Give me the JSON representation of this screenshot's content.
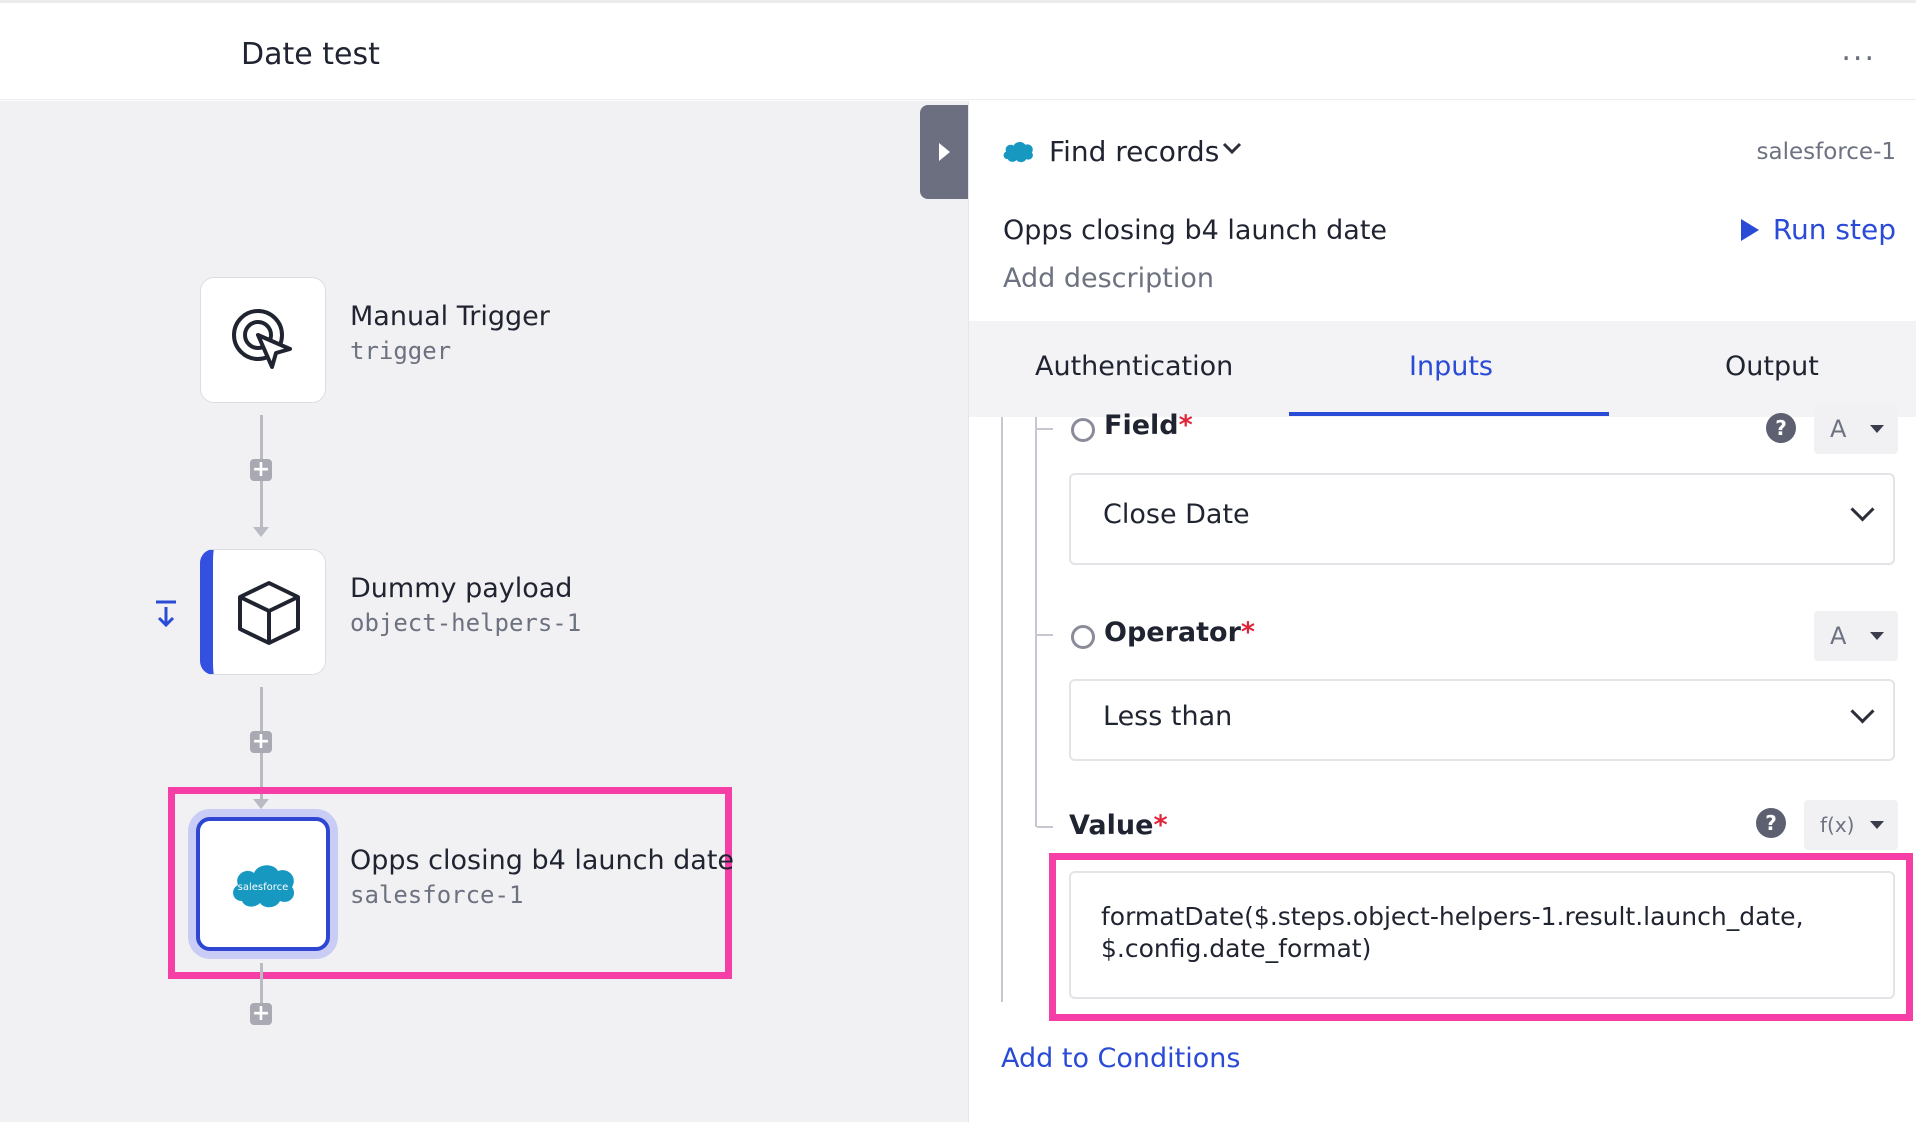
{
  "header": {
    "title": "Date test",
    "more_label": "..."
  },
  "canvas": {
    "nodes": [
      {
        "title": "Manual Trigger",
        "subtitle": "trigger",
        "icon": "cursor-click-icon"
      },
      {
        "title": "Dummy payload",
        "subtitle": "object-helpers-1",
        "icon": "cube-icon"
      },
      {
        "title": "Opps closing b4 launch date",
        "subtitle": "salesforce-1",
        "icon": "salesforce-logo-icon",
        "logo_text": "salesforce"
      }
    ],
    "add_step_symbol": "+"
  },
  "panel": {
    "step_type": "Find records",
    "step_id": "salesforce-1",
    "step_name": "Opps closing b4 launch date",
    "run_step_label": "Run step",
    "add_description": "Add description",
    "tabs": [
      {
        "label": "Authentication"
      },
      {
        "label": "Inputs",
        "active": true
      },
      {
        "label": "Output"
      }
    ],
    "fields": {
      "field": {
        "label": "Field",
        "required_mark": "*",
        "type_label": "A",
        "value": "Close Date"
      },
      "operator": {
        "label": "Operator",
        "required_mark": "*",
        "type_label": "A",
        "value": "Less than"
      },
      "value": {
        "label": "Value",
        "required_mark": "*",
        "type_label": "f(x)",
        "expression_line1": "formatDate($.steps.object-helpers-1.result.launch_date,",
        "expression_line2": "$.config.date_format)"
      }
    },
    "help_symbol": "?",
    "add_conditions_label": "Add to Conditions"
  },
  "colors": {
    "accent": "#2a4bd6",
    "highlight": "#f53fa7",
    "salesforce": "#1798c1",
    "required": "#e0243a"
  }
}
